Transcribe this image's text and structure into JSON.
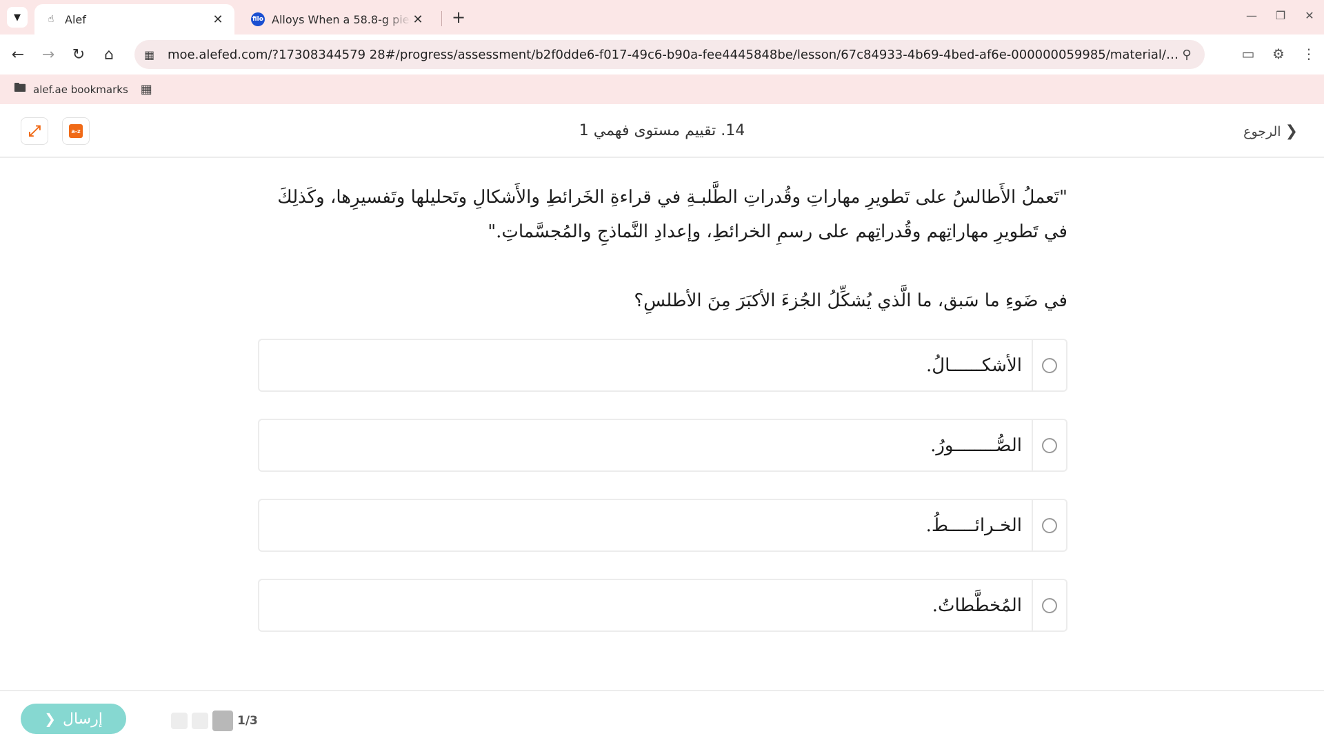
{
  "browser": {
    "tabs": [
      {
        "title": "Alef",
        "active": true,
        "icon": "hand-icon"
      },
      {
        "title": "Alloys When a 58.8-g piece of h",
        "active": false,
        "icon": "filo-icon",
        "icon_text": "filo"
      }
    ],
    "url": "moe.alefed.com/?17308344579 28#/progress/assessment/b2f0dde6-f017-49c6-b90a-fee4445848be/lesson/67c84933-4b69-4bed-af6e-000000059985/material/ddbe2937-d388-4188-...",
    "bookmark_folder": "alef.ae bookmarks"
  },
  "header": {
    "lesson_title": "14. تقييم مستوى فهمي 1",
    "back_label": "الرجوع",
    "book_icon_text": "a-z"
  },
  "content": {
    "passage": "\"تَعملُ الأَطالسُ على تَطويرِ مهاراتِ وقُدراتِ الطَّلبـةِ في قراءةِ الخَرائطِ والأَشكالِ وتَحليلها وتَفسيرِها، وكَذلِكَ في تَطويرِ مهاراتِهم وقُدراتِهم على رسمِ الخرائطِ، وإعدادِ النَّماذجِ والمُجسَّماتِ.\"",
    "question": "في ضَوءِ ما سَبق، ما الَّذي يُشكِّلُ الجُزءَ الأكبَرَ مِنَ الأطلسِ؟",
    "options": [
      {
        "label": "الأشكــــــالُ."
      },
      {
        "label": "الصُّــــــــورُ."
      },
      {
        "label": "الخـرائـــــطُ."
      },
      {
        "label": "المُخطَّطاتُ."
      }
    ]
  },
  "footer": {
    "submit_label": "إرسال",
    "progress_text": "1/3",
    "progress_current": 1,
    "progress_total": 3
  },
  "colors": {
    "chrome_bg": "#fbe7e7",
    "accent_orange": "#f06a17",
    "submit_teal": "#86d8d1"
  }
}
